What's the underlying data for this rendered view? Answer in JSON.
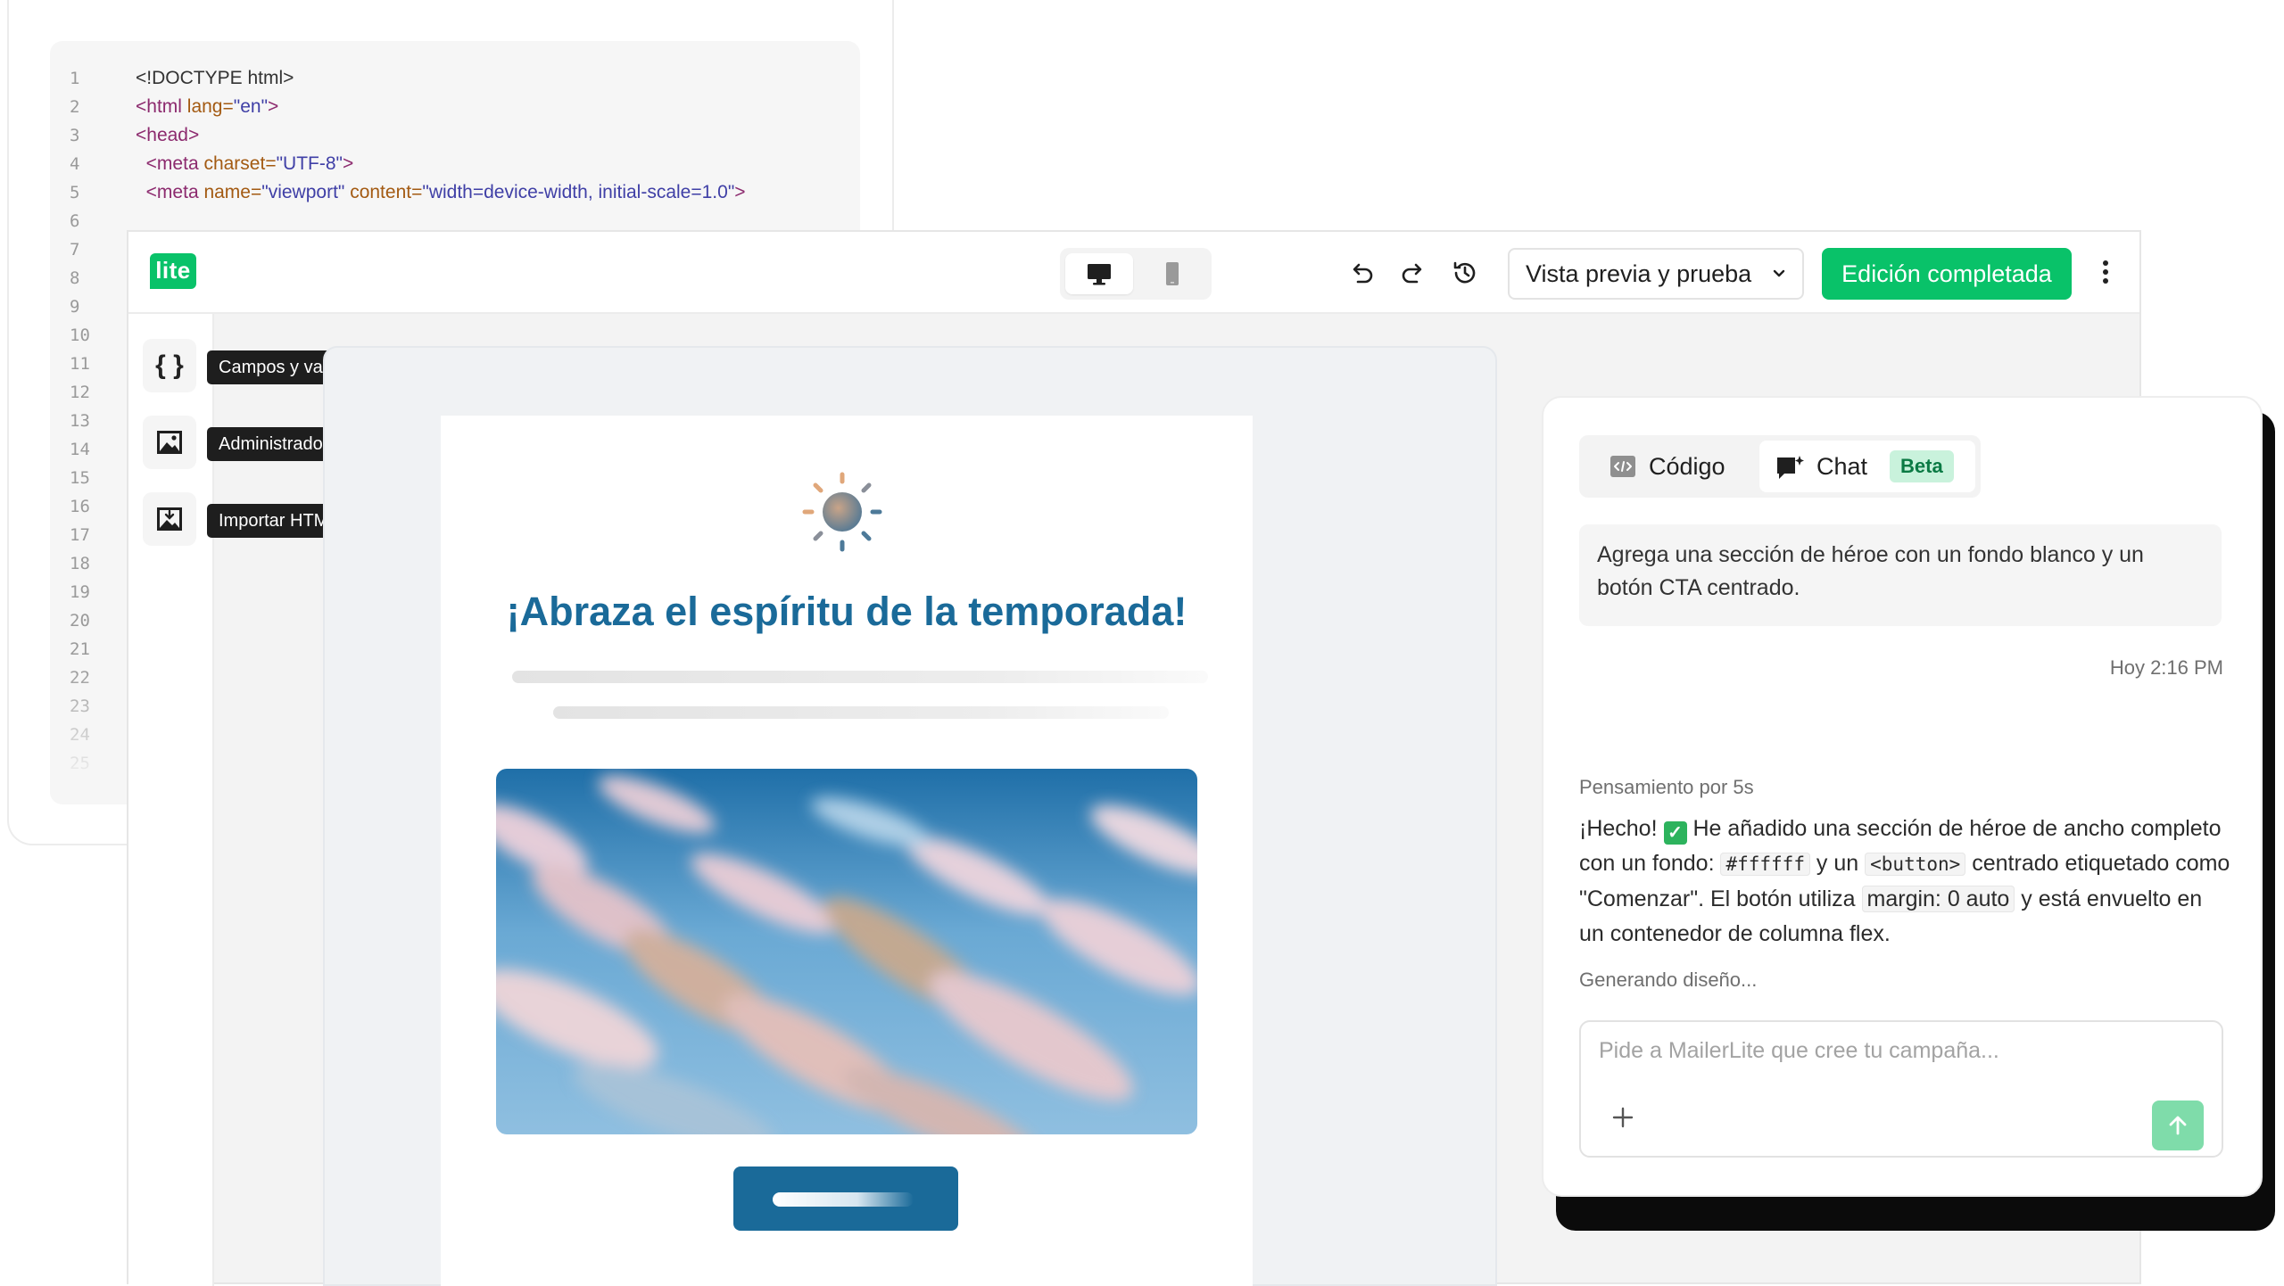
{
  "code_editor": {
    "lines": [
      {
        "n": "1",
        "parts": [
          [
            "doc",
            "<!DOCTYPE html>"
          ]
        ]
      },
      {
        "n": "2",
        "parts": [
          [
            "tag",
            "<html "
          ],
          [
            "attr",
            "lang="
          ],
          [
            "str",
            "\"en\""
          ],
          [
            "tag",
            ">"
          ]
        ]
      },
      {
        "n": "3",
        "parts": [
          [
            "tag",
            "<head>"
          ]
        ]
      },
      {
        "n": "4",
        "parts": [
          [
            "tag",
            "  <meta "
          ],
          [
            "attr",
            "charset="
          ],
          [
            "str",
            "\"UTF-8\""
          ],
          [
            "tag",
            ">"
          ]
        ]
      },
      {
        "n": "5",
        "parts": [
          [
            "tag",
            "  <meta "
          ],
          [
            "attr",
            "name="
          ],
          [
            "str",
            "\"viewport\" "
          ],
          [
            "attr",
            "content="
          ],
          [
            "str",
            "\"width=device-width, initial-scale=1.0\""
          ],
          [
            "tag",
            ">"
          ]
        ]
      },
      {
        "n": "6",
        "parts": []
      },
      {
        "n": "7",
        "parts": []
      },
      {
        "n": "8",
        "parts": []
      },
      {
        "n": "9",
        "parts": []
      },
      {
        "n": "10",
        "parts": []
      },
      {
        "n": "11",
        "parts": []
      },
      {
        "n": "12",
        "parts": []
      },
      {
        "n": "13",
        "parts": []
      },
      {
        "n": "14",
        "parts": []
      },
      {
        "n": "15",
        "parts": []
      },
      {
        "n": "16",
        "parts": []
      },
      {
        "n": "17",
        "parts": []
      },
      {
        "n": "18",
        "parts": []
      },
      {
        "n": "19",
        "parts": []
      },
      {
        "n": "20",
        "parts": []
      },
      {
        "n": "21",
        "parts": []
      },
      {
        "n": "22",
        "parts": []
      },
      {
        "n": "23",
        "parts": []
      },
      {
        "n": "24",
        "parts": []
      },
      {
        "n": "25",
        "parts": []
      }
    ]
  },
  "topbar": {
    "logo": "lite",
    "preview_select": "Vista previa y prueba",
    "done_button": "Edición completada"
  },
  "tools": [
    {
      "icon": "braces-icon",
      "tooltip": "Campos y variables"
    },
    {
      "icon": "image-icon",
      "tooltip": "Administrador de archivos"
    },
    {
      "icon": "import-html-icon",
      "tooltip": "Importar HTML"
    }
  ],
  "email": {
    "title": "¡Abraza el espíritu de la temporada!"
  },
  "chat": {
    "tabs": {
      "code": "Código",
      "chat": "Chat",
      "beta": "Beta"
    },
    "user_message": "Agrega una sección de héroe con un fondo blanco y un botón CTA centrado.",
    "timestamp": "Hoy 2:16 PM",
    "thinking": "Pensamiento por 5s",
    "reply": {
      "r1": "¡Hecho!",
      "r2": " He añadido una sección de héroe de ancho completo con un fondo: ",
      "c1": "#ffffff",
      "r3": " y un ",
      "c2": "<button>",
      "r4": " centrado etiquetado como \"Comenzar\". El botón utiliza ",
      "c3": "margin: 0 auto",
      "r5": " y está envuelto en un contenedor de columna flex."
    },
    "generating": "Generando diseño...",
    "composer_placeholder": "Pide a MailerLite que cree tu campaña..."
  },
  "colors": {
    "brand_green": "#09c269",
    "email_title": "#1a6a99",
    "cta_blue": "#1a6a99",
    "beta_badge": "#c9f2dc"
  }
}
